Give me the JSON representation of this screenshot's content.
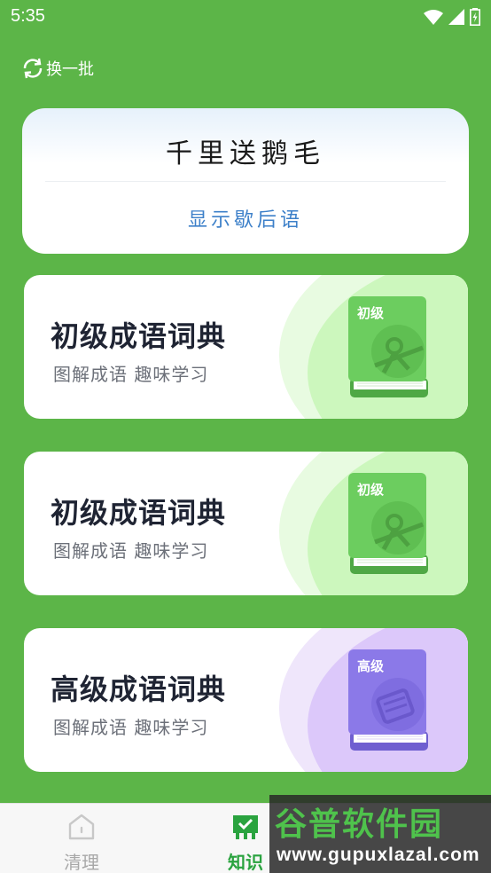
{
  "status_bar": {
    "time": "5:35"
  },
  "refresh": {
    "label": "换一批"
  },
  "riddle": {
    "text": "千里送鹅毛",
    "show_label": "显示歇后语"
  },
  "cards": [
    {
      "title": "初级成语词典",
      "subtitle": "图解成语 趣味学习",
      "badge": "初级",
      "theme": "green"
    },
    {
      "title": "初级成语词典",
      "subtitle": "图解成语 趣味学习",
      "badge": "初级",
      "theme": "green"
    },
    {
      "title": "高级成语词典",
      "subtitle": "图解成语 趣味学习",
      "badge": "高级",
      "theme": "purple"
    }
  ],
  "nav": {
    "items": [
      {
        "label": "清理",
        "icon": "home-icon",
        "active": false
      },
      {
        "label": "知识",
        "icon": "knowledge-icon",
        "active": true
      }
    ]
  },
  "watermark": {
    "title": "谷普软件园",
    "url": "www.gupuxlazal.com"
  },
  "colors": {
    "background": "#5cb548",
    "active_nav": "#2aa33f",
    "link_blue": "#3d80c9",
    "green_book": "#6ccd5f",
    "purple_book": "#8b79e8"
  }
}
